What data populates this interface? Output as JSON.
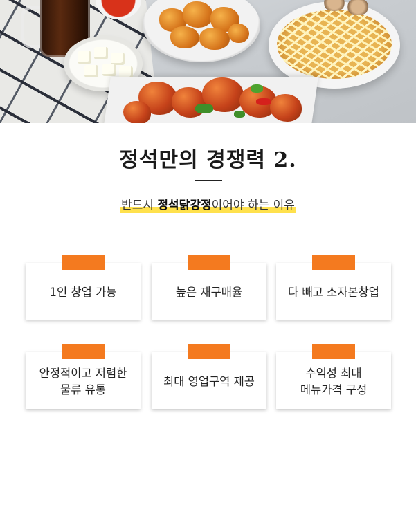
{
  "hero": {
    "image": "korean-fried-chicken-photo"
  },
  "title": "정석만의 경쟁력 2.",
  "subtitle": {
    "prefix": "반드시 ",
    "brand": "정석닭강정",
    "suffix": "이어야 하는 이유"
  },
  "colors": {
    "accent_tab": "#f47a1f",
    "highlight": "#ffe14d"
  },
  "cards": [
    {
      "label": "1인 창업 가능"
    },
    {
      "label": "높은 재구매율"
    },
    {
      "label": "다 빼고 소자본창업"
    },
    {
      "label": "안정적이고 저렴한\n물류 유통"
    },
    {
      "label": "최대 영업구역 제공"
    },
    {
      "label": "수익성 최대\n메뉴가격 구성"
    }
  ]
}
